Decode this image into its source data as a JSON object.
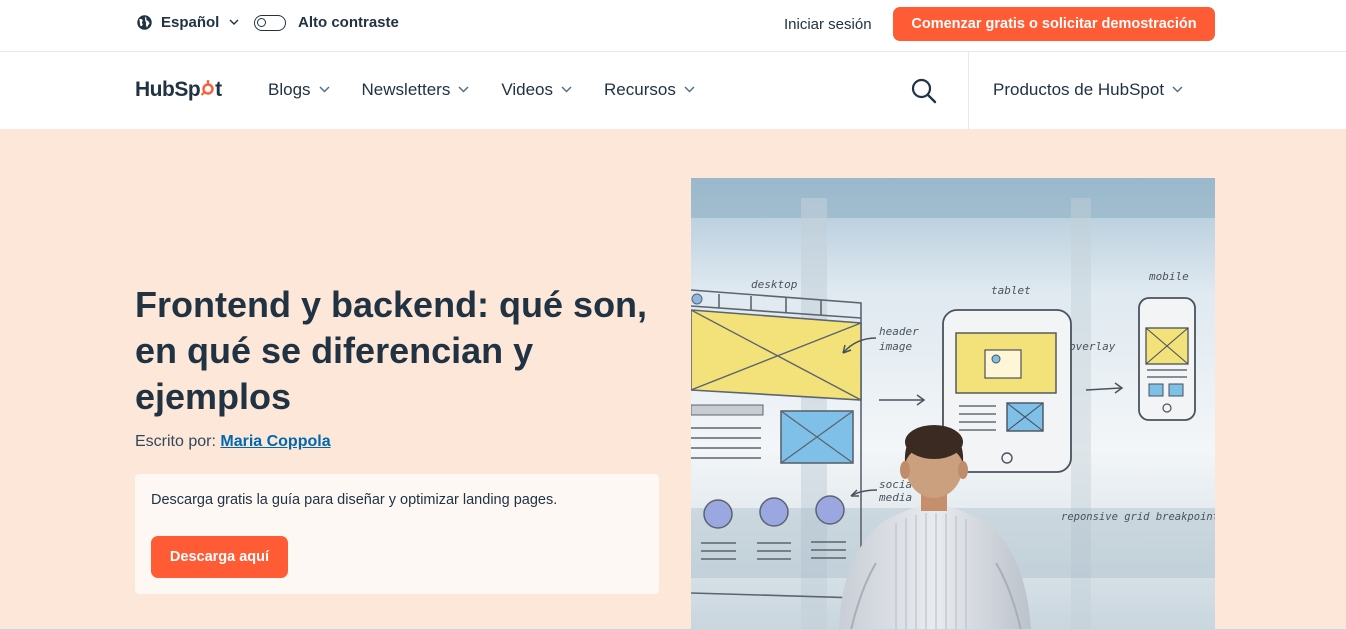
{
  "utility": {
    "language": "Español",
    "contrast_label": "Alto contraste",
    "login": "Iniciar sesión",
    "cta": "Comenzar gratis o solicitar demostración"
  },
  "nav": {
    "logo_hub": "HubSp",
    "logo_o": "o",
    "logo_t": "t",
    "items": [
      {
        "label": "Blogs"
      },
      {
        "label": "Newsletters"
      },
      {
        "label": "Videos"
      },
      {
        "label": "Recursos"
      }
    ],
    "products": "Productos de HubSpot"
  },
  "hero": {
    "title": "Frontend y backend: qué son, en qué se diferencian y ejemplos",
    "author_prefix": "Escrito por: ",
    "author_name": "Maria Coppola",
    "offer_text": "Descarga gratis la guía para diseñar y optimizar landing pages.",
    "offer_button": "Descarga aquí"
  },
  "illustration": {
    "label_desktop": "desktop",
    "label_tablet": "tablet",
    "label_mobile": "mobile",
    "label_header": "header",
    "label_image": "image",
    "label_overlay": "overlay",
    "label_social": "social",
    "label_media": "media",
    "label_grid": "reponsive grid breakpoints?"
  },
  "colors": {
    "accent": "#ff5c35",
    "hero_bg": "#fce7d8",
    "text": "#213343",
    "link": "#0068b1"
  }
}
